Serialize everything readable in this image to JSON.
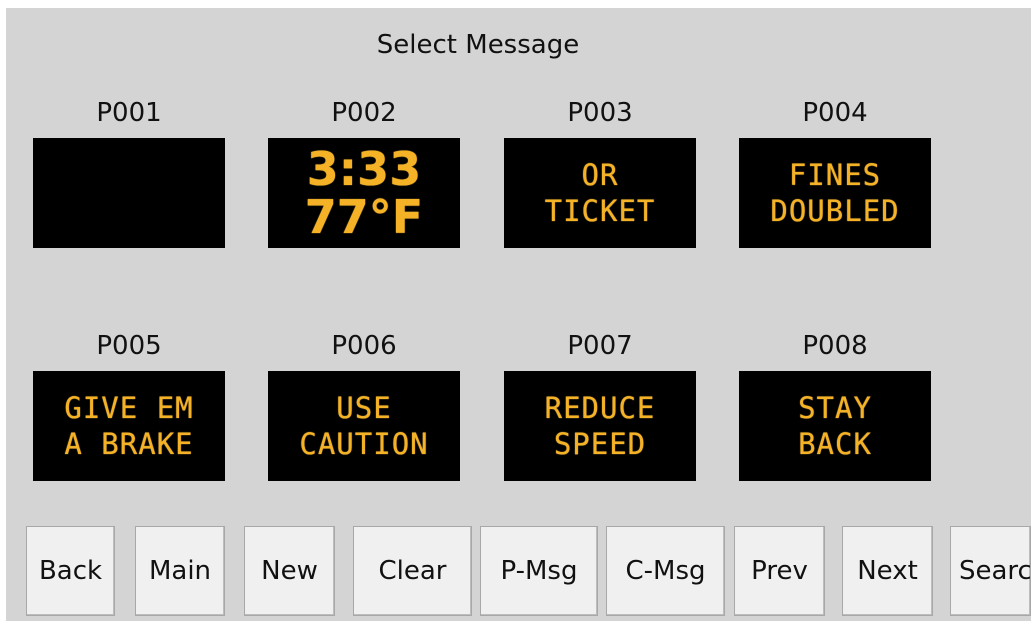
{
  "screen": {
    "title": "Select Message"
  },
  "messages": [
    {
      "id": "P001",
      "lines": [
        "",
        ""
      ]
    },
    {
      "id": "P002",
      "lines": [
        "3:33",
        "77°F"
      ]
    },
    {
      "id": "P003",
      "lines": [
        "OR",
        "TICKET"
      ]
    },
    {
      "id": "P004",
      "lines": [
        "FINES",
        "DOUBLED"
      ]
    },
    {
      "id": "P005",
      "lines": [
        "GIVE EM",
        "A BRAKE"
      ]
    },
    {
      "id": "P006",
      "lines": [
        "USE",
        "CAUTION"
      ]
    },
    {
      "id": "P007",
      "lines": [
        "REDUCE",
        "SPEED"
      ]
    },
    {
      "id": "P008",
      "lines": [
        "STAY",
        "BACK"
      ]
    }
  ],
  "buttons": {
    "back": "Back",
    "main": "Main",
    "new": "New",
    "clear": "Clear",
    "pmsg": "P-Msg",
    "cmsg": "C-Msg",
    "prev": "Prev",
    "next": "Next",
    "search": "Search"
  },
  "colors": {
    "background": "#d4d4d4",
    "sign_background": "#000000",
    "sign_text": "#f5b226",
    "button_face": "#f0f0f0"
  }
}
